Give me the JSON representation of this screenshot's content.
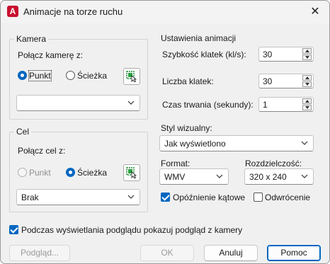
{
  "window": {
    "title": "Animacje na torze ruchu",
    "app_icon_letter": "A"
  },
  "camera": {
    "legend": "Kamera",
    "link_label": "Połącz kamerę z:",
    "radio_point": "Punkt",
    "radio_path": "Ścieżka",
    "selected": "Punkt",
    "combo_value": ""
  },
  "target": {
    "legend": "Cel",
    "link_label": "Połącz cel z:",
    "radio_point": "Punkt",
    "radio_path": "Ścieżka",
    "selected": "Ścieżka",
    "combo_value": "Brak"
  },
  "animation": {
    "legend": "Ustawienia animacji",
    "fps_label": "Szybkość klatek (kl/s):",
    "fps_value": "30",
    "frames_label": "Liczba klatek:",
    "frames_value": "30",
    "duration_label": "Czas trwania (sekundy):",
    "duration_value": "1",
    "visual_style_label": "Styl wizualny:",
    "visual_style_value": "Jak wyświetlono",
    "format_label": "Format:",
    "format_value": "WMV",
    "resolution_label": "Rozdzielczość:",
    "resolution_value": "320 x 240",
    "corner_deceleration_label": "Opóźnienie kątowe",
    "corner_deceleration_checked": true,
    "reverse_label": "Odwrócenie",
    "reverse_checked": false
  },
  "preview_checkbox": {
    "label": "Podczas wyświetlania podglądu pokazuj podgląd z kamery",
    "checked": true
  },
  "buttons": {
    "preview": "Podgląd...",
    "ok": "OK",
    "cancel": "Anuluj",
    "help": "Pomoc"
  },
  "colors": {
    "accent": "#0067c0",
    "app_icon": "#c8102e"
  }
}
